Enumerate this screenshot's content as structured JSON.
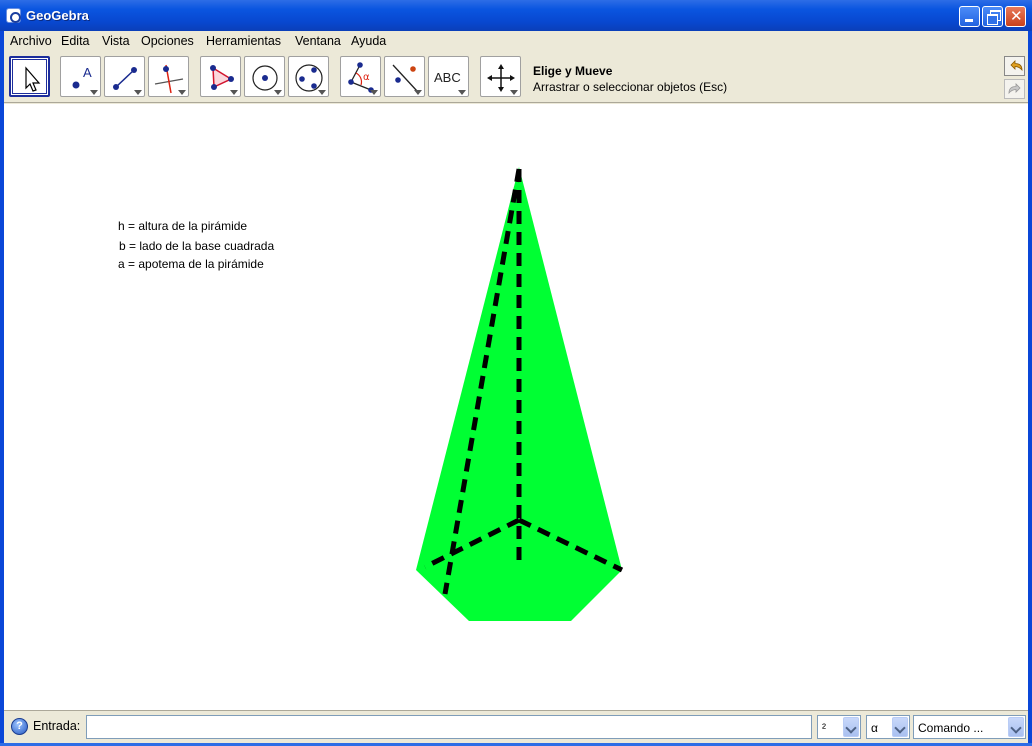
{
  "window": {
    "title": "GeoGebra"
  },
  "menu": {
    "items": [
      "Archivo",
      "Edita",
      "Vista",
      "Opciones",
      "Herramientas",
      "Ventana",
      "Ayuda"
    ]
  },
  "toolbar": {
    "tools": [
      {
        "name": "move-tool",
        "selected": true
      },
      {
        "name": "point-tool"
      },
      {
        "name": "line-tool"
      },
      {
        "name": "perpendicular-tool"
      },
      {
        "name": "polygon-tool"
      },
      {
        "name": "circle-center-tool"
      },
      {
        "name": "circle-three-points-tool"
      },
      {
        "name": "angle-tool"
      },
      {
        "name": "reflect-tool"
      },
      {
        "name": "text-tool",
        "label": "ABC"
      },
      {
        "name": "move-graphics-tool"
      }
    ],
    "help_title": "Elige y Mueve",
    "help_desc": "Arrastrar o seleccionar objetos (Esc)"
  },
  "graphics": {
    "legend": [
      "h = altura de la pirámide",
      "b = lado de la base cuadrada",
      "a = apotema de la pirámide"
    ],
    "pyramid_fill": "#00ff33",
    "dash_color": "#000000"
  },
  "inputbar": {
    "label": "Entrada:",
    "value": "",
    "symbol_combo": "²",
    "greek_combo": "α",
    "command_combo": "Comando ..."
  }
}
